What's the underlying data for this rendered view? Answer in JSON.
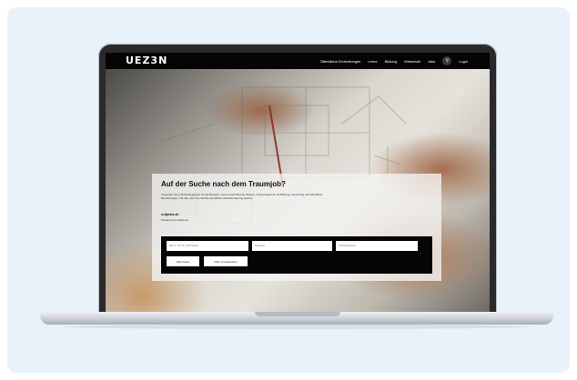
{
  "header": {
    "logo_text": "UEZ3N",
    "nav_items": [
      "Öffentliche Einrichtungen",
      "Lehre",
      "Bildung",
      "Wirtschaft",
      "Jobs"
    ],
    "login_label": "Login",
    "search_icon": "search-icon"
  },
  "hero": {
    "title": "Auf der Suche nach dem Traumjob?",
    "text": "Tausende neue Stellenangebote für die Bereiche Lehre (auch Berufe) Wissen, Nutzerangebote für Bildung, Forschung und öffentliche Einrichtungen. Für alle, die ihre nächste berufliche Herausforderung suchen.",
    "brand": "unijobs.at",
    "brand_sub": "Powered by unijobs.at"
  },
  "search": {
    "field1_placeholder": "Beruf, Firma, Stichworte",
    "field2_placeholder": "Standort",
    "field3_placeholder": "Anstellungsart",
    "find_jobs_label": "Jobs finden",
    "reset_filter_label": "Filter zurücksetzen"
  },
  "colors": {
    "background_panel": "#e9f1fa",
    "nav_bg": "#050505",
    "search_bg": "#050505"
  }
}
